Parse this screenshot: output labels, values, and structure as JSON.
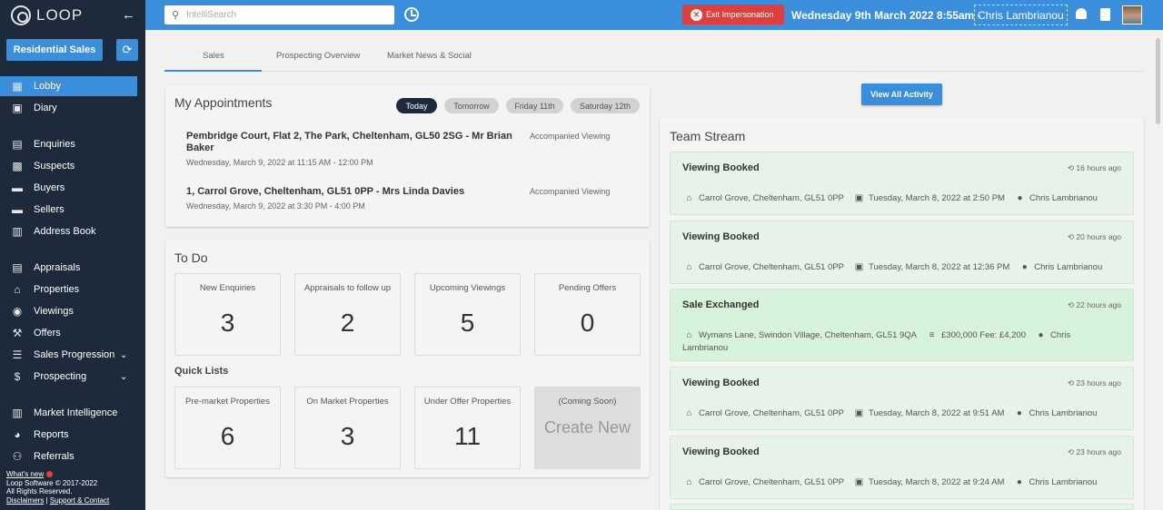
{
  "app": {
    "name": "LOOP"
  },
  "branch": {
    "label": "Residential Sales"
  },
  "nav": [
    {
      "label": "Lobby",
      "icon": "dashboard-icon",
      "active": true
    },
    {
      "label": "Diary",
      "icon": "calendar-icon"
    },
    {
      "label": "Enquiries",
      "icon": "enquiries-icon"
    },
    {
      "label": "Suspects",
      "icon": "suspects-icon"
    },
    {
      "label": "Buyers",
      "icon": "buyers-icon"
    },
    {
      "label": "Sellers",
      "icon": "sellers-icon"
    },
    {
      "label": "Address Book",
      "icon": "book-icon"
    },
    {
      "label": "Appraisals",
      "icon": "clipboard-icon"
    },
    {
      "label": "Properties",
      "icon": "properties-icon"
    },
    {
      "label": "Viewings",
      "icon": "eye-icon"
    },
    {
      "label": "Offers",
      "icon": "gavel-icon"
    },
    {
      "label": "Sales Progression",
      "icon": "progression-icon"
    },
    {
      "label": "Prospecting",
      "icon": "dollar-icon"
    },
    {
      "label": "Market Intelligence",
      "icon": "chart-icon"
    },
    {
      "label": "Reports",
      "icon": "pie-icon"
    },
    {
      "label": "Referrals",
      "icon": "referrals-icon"
    }
  ],
  "footer": {
    "whats_new": "What's new",
    "copyright": "Loop Software © 2017-2022",
    "rights": "All Rights Reserved.",
    "disclaimers": "Disclaimers",
    "separator": "|",
    "support": "Support & Contact"
  },
  "topbar": {
    "search_placeholder": "IntelliSearch",
    "exit_label": "Exit Impersonation",
    "datetime": "Wednesday 9th March 2022 8:55am -",
    "user": "Chris Lambrianou"
  },
  "tabs": [
    "Sales",
    "Prospecting Overview",
    "Market News & Social"
  ],
  "appointments": {
    "title": "My Appointments",
    "filters": [
      "Today",
      "Tomorrow",
      "Friday 11th",
      "Saturday 12th"
    ],
    "items": [
      {
        "address": "Pembridge Court, Flat 2, The Park, Cheltenham, GL50 2SG - Mr Brian Baker",
        "time": "Wednesday, March 9, 2022 at 11:15 AM - 12:00 PM",
        "type": "Accompanied Viewing"
      },
      {
        "address": "1, Carrol Grove, Cheltenham, GL51 0PP - Mrs Linda Davies",
        "time": "Wednesday, March 9, 2022 at 3:30 PM - 4:00 PM",
        "type": "Accompanied Viewing"
      }
    ]
  },
  "todo": {
    "title": "To Do",
    "tiles": [
      {
        "label": "New Enquiries",
        "value": "3"
      },
      {
        "label": "Appraisals to follow up",
        "value": "2"
      },
      {
        "label": "Upcoming Viewings",
        "value": "5"
      },
      {
        "label": "Pending Offers",
        "value": "0"
      }
    ]
  },
  "quick_lists": {
    "title": "Quick Lists",
    "tiles": [
      {
        "label": "Pre-market Properties",
        "value": "6"
      },
      {
        "label": "On Market Properties",
        "value": "3"
      },
      {
        "label": "Under Offer Properties",
        "value": "11"
      }
    ],
    "soon_label": "(Coming Soon)",
    "soon_big": "Create New"
  },
  "stream": {
    "view_all": "View All Activity",
    "title": "Team Stream",
    "items": [
      {
        "title": "Viewing Booked",
        "ago": "16 hours ago",
        "address": "Carrol Grove, Cheltenham, GL51 0PP",
        "date": "Tuesday, March 8, 2022 at 2:50 PM",
        "user": "Chris Lambrianou"
      },
      {
        "title": "Viewing Booked",
        "ago": "20 hours ago",
        "address": "Carrol Grove, Cheltenham, GL51 0PP",
        "date": "Tuesday, March 8, 2022 at 12:36 PM",
        "user": "Chris Lambrianou"
      },
      {
        "title": "Sale Exchanged",
        "ago": "22 hours ago",
        "address": "Wymans Lane, Swindon Village, Cheltenham, GL51 9QA",
        "price": "£300,000 Fee: £4,200",
        "user_line1": "Chris",
        "user_line2": "Lambrianou"
      },
      {
        "title": "Viewing Booked",
        "ago": "23 hours ago",
        "address": "Carrol Grove, Cheltenham, GL51 0PP",
        "date": "Tuesday, March 8, 2022 at 9:51 AM",
        "user": "Chris Lambrianou"
      },
      {
        "title": "Viewing Booked",
        "ago": "23 hours ago",
        "address": "Carrol Grove, Cheltenham, GL51 0PP",
        "date": "Tuesday, March 8, 2022 at 9:24 AM",
        "user": "Chris Lambrianou"
      }
    ]
  }
}
